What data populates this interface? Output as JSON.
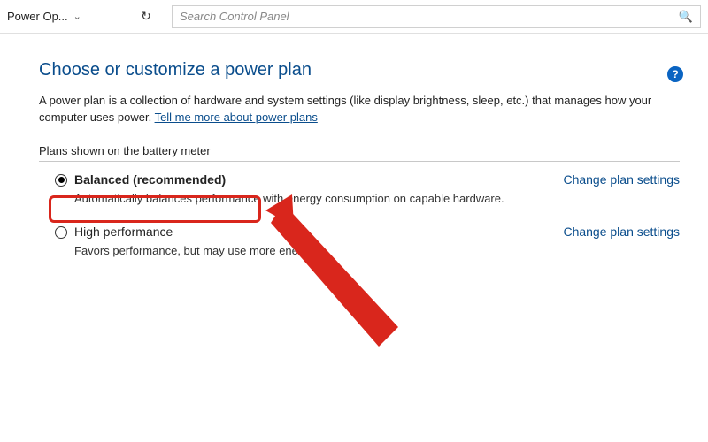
{
  "topbar": {
    "breadcrumb": "Power Op...",
    "search_placeholder": "Search Control Panel"
  },
  "page": {
    "title": "Choose or customize a power plan",
    "description_part1": "A power plan is a collection of hardware and system settings (like display brightness, sleep, etc.) that manages how your computer uses power. ",
    "description_link": "Tell me more about power plans",
    "section_label": "Plans shown on the battery meter"
  },
  "plans": [
    {
      "name": "Balanced (recommended)",
      "description": "Automatically balances performance with energy consumption on capable hardware.",
      "selected": true,
      "change_link": "Change plan settings"
    },
    {
      "name": "High performance",
      "description": "Favors performance, but may use more energy.",
      "selected": false,
      "change_link": "Change plan settings"
    }
  ],
  "help_tooltip": "?"
}
